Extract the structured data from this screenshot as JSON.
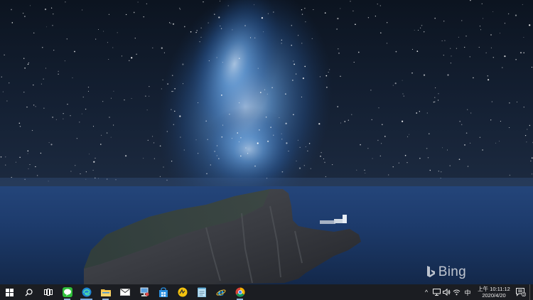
{
  "desktop": {
    "watermark_text": "Bing"
  },
  "taskbar": {
    "pinned": [
      {
        "name": "start-button",
        "icon": "windows-logo-icon"
      },
      {
        "name": "search-button",
        "icon": "search-icon"
      },
      {
        "name": "task-view-button",
        "icon": "task-view-icon"
      },
      {
        "name": "line-app-button",
        "icon": "line-chat-icon"
      },
      {
        "name": "edge-app-button",
        "icon": "edge-browser-icon"
      },
      {
        "name": "file-explorer-button",
        "icon": "folder-icon"
      },
      {
        "name": "mail-app-button",
        "icon": "mail-icon"
      },
      {
        "name": "network-app-button",
        "icon": "network-pc-icon"
      },
      {
        "name": "store-app-button",
        "icon": "store-bag-icon"
      },
      {
        "name": "unknown-app-button",
        "icon": "yellow-app-icon"
      },
      {
        "name": "notepad-app-button",
        "icon": "notepad-icon"
      },
      {
        "name": "ie-app-button",
        "icon": "internet-explorer-icon"
      },
      {
        "name": "chrome-app-button",
        "icon": "chrome-icon"
      }
    ],
    "tray": {
      "chevron": "^",
      "ime_label": "中",
      "time": "上午 10:11:12",
      "date": "2020/4/20",
      "notification_count": "3"
    }
  },
  "colors": {
    "taskbar_bg": "#1b1d22",
    "accent": "#7aa7d8"
  }
}
